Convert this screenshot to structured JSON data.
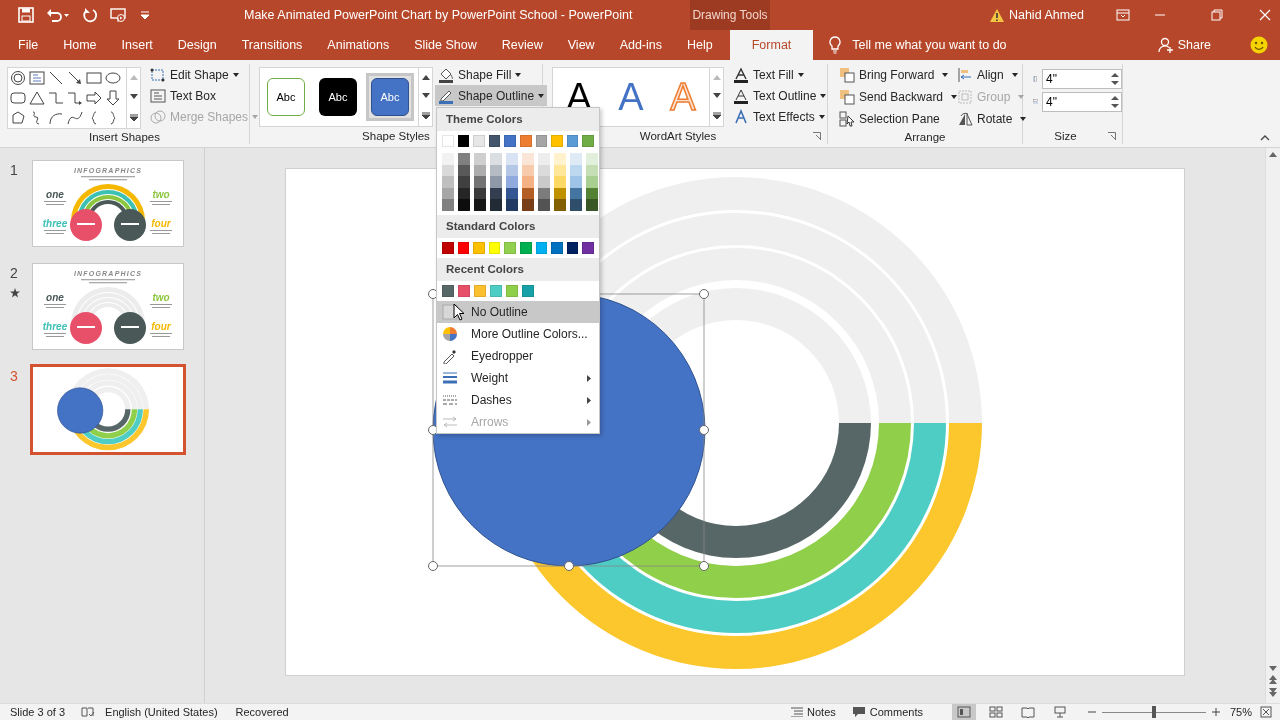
{
  "title_bar": {
    "title": "Make Animated PowerPoint Chart by PowerPoint School  -  PowerPoint",
    "context_tab_group": "Drawing Tools",
    "user": "Nahid Ahmed"
  },
  "tabs": [
    {
      "label": "File",
      "selected": false
    },
    {
      "label": "Home",
      "selected": false
    },
    {
      "label": "Insert",
      "selected": false
    },
    {
      "label": "Design",
      "selected": false
    },
    {
      "label": "Transitions",
      "selected": false
    },
    {
      "label": "Animations",
      "selected": false
    },
    {
      "label": "Slide Show",
      "selected": false
    },
    {
      "label": "Review",
      "selected": false
    },
    {
      "label": "View",
      "selected": false
    },
    {
      "label": "Add-ins",
      "selected": false
    },
    {
      "label": "Help",
      "selected": false
    },
    {
      "label": "Format",
      "selected": true
    }
  ],
  "tell_me": {
    "placeholder": "Tell me what you want to do"
  },
  "share": "Share",
  "ribbon": {
    "insert_shapes": {
      "label": "Insert Shapes",
      "commands": [
        {
          "label": "Edit Shape",
          "dropdown": true,
          "disabled": false
        },
        {
          "label": "Text Box",
          "dropdown": false,
          "disabled": false
        },
        {
          "label": "Merge Shapes",
          "dropdown": true,
          "disabled": true
        }
      ]
    },
    "shape_styles": {
      "label": "Shape Styles",
      "presets": [
        {
          "label": "Abc",
          "kind": "outline",
          "selected": false
        },
        {
          "label": "Abc",
          "kind": "dark",
          "selected": false
        },
        {
          "label": "Abc",
          "kind": "blue",
          "selected": true
        }
      ],
      "commands": [
        {
          "label": "Shape Fill",
          "expanded": false
        },
        {
          "label": "Shape Outline",
          "expanded": true
        }
      ]
    },
    "wordart_styles": {
      "label": "WordArt Styles",
      "presets": [
        {
          "label": "A",
          "kind": "black"
        },
        {
          "label": "A",
          "kind": "blue"
        },
        {
          "label": "A",
          "kind": "orange"
        }
      ],
      "commands": [
        {
          "label": "Text Fill"
        },
        {
          "label": "Text Outline"
        },
        {
          "label": "Text Effects"
        }
      ]
    },
    "arrange": {
      "label": "Arrange",
      "commands": [
        {
          "label": "Bring Forward",
          "dropdown": true,
          "disabled": false
        },
        {
          "label": "Align",
          "dropdown": true,
          "disabled": false
        },
        {
          "label": "Send Backward",
          "dropdown": true,
          "disabled": false
        },
        {
          "label": "Group",
          "dropdown": true,
          "disabled": true
        },
        {
          "label": "Selection Pane",
          "dropdown": false,
          "disabled": false
        },
        {
          "label": "Rotate",
          "dropdown": true,
          "disabled": false
        }
      ]
    },
    "size": {
      "label": "Size",
      "fields": [
        {
          "value": "4\""
        },
        {
          "value": "4\""
        }
      ]
    }
  },
  "outline_menu": {
    "theme_heading": "Theme Colors",
    "theme_colors": [
      {
        "color": "#ffffff"
      },
      {
        "color": "#000000"
      },
      {
        "color": "#e7e6e6"
      },
      {
        "color": "#44546a"
      },
      {
        "color": "#4472c4"
      },
      {
        "color": "#ed7d31"
      },
      {
        "color": "#a5a5a5"
      },
      {
        "color": "#ffc000"
      },
      {
        "color": "#5b9bd5"
      },
      {
        "color": "#70ad47"
      }
    ],
    "standard_heading": "Standard Colors",
    "standard_colors": [
      {
        "color": "#c00000"
      },
      {
        "color": "#ff0000"
      },
      {
        "color": "#ffc000"
      },
      {
        "color": "#ffff00"
      },
      {
        "color": "#92d050"
      },
      {
        "color": "#00b050"
      },
      {
        "color": "#00b0f0"
      },
      {
        "color": "#0070c0"
      },
      {
        "color": "#002060"
      },
      {
        "color": "#7030a0"
      }
    ],
    "recent_heading": "Recent Colors",
    "recent_colors": [
      {
        "color": "#576767"
      },
      {
        "color": "#e8506a"
      },
      {
        "color": "#fbc02d"
      },
      {
        "color": "#4ecdc4"
      },
      {
        "color": "#8fcf4a"
      },
      {
        "color": "#17a2a8"
      }
    ],
    "items": [
      {
        "label": "No Outline",
        "kind": "none",
        "highlighted": true,
        "submenu": false,
        "disabled": false
      },
      {
        "label": "More Outline Colors...",
        "kind": "palette",
        "highlighted": false,
        "submenu": false,
        "disabled": false
      },
      {
        "label": "Eyedropper",
        "kind": "eyedropper",
        "highlighted": false,
        "submenu": false,
        "disabled": false
      },
      {
        "label": "Weight",
        "kind": "weight",
        "highlighted": false,
        "submenu": true,
        "disabled": false
      },
      {
        "label": "Dashes",
        "kind": "dashes",
        "highlighted": false,
        "submenu": true,
        "disabled": false
      },
      {
        "label": "Arrows",
        "kind": "arrows",
        "highlighted": false,
        "submenu": true,
        "disabled": true
      }
    ]
  },
  "slides": [
    {
      "number": "1",
      "selected": false,
      "animated": false,
      "kind": "infographic",
      "title": "INFOGRAPHICS",
      "labels": [
        {
          "text": "one",
          "color": "#4a5858"
        },
        {
          "text": "two",
          "color": "#8cc63f"
        },
        {
          "text": "three",
          "color": "#3cc0b4"
        },
        {
          "text": "four",
          "color": "#f5b800"
        }
      ]
    },
    {
      "number": "2",
      "selected": false,
      "animated": true,
      "kind": "infographic-plain",
      "title": "INFOGRAPHICS",
      "labels": [
        {
          "text": "one",
          "color": "#4a5858"
        },
        {
          "text": "two",
          "color": "#8cc63f"
        },
        {
          "text": "three",
          "color": "#3cc0b4"
        },
        {
          "text": "four",
          "color": "#f5b800"
        }
      ]
    },
    {
      "number": "3",
      "selected": true,
      "animated": false,
      "kind": "rings"
    }
  ],
  "status_bar": {
    "slide_indicator": "Slide 3 of 3",
    "language": "English (United States)",
    "save_state": "Recovered",
    "notes": "Notes",
    "comments": "Comments",
    "views": [
      {
        "selected": true
      },
      {
        "selected": false
      },
      {
        "selected": false
      },
      {
        "selected": false
      }
    ],
    "zoom_slider": {
      "level": 0.5
    },
    "zoom": "75%"
  }
}
